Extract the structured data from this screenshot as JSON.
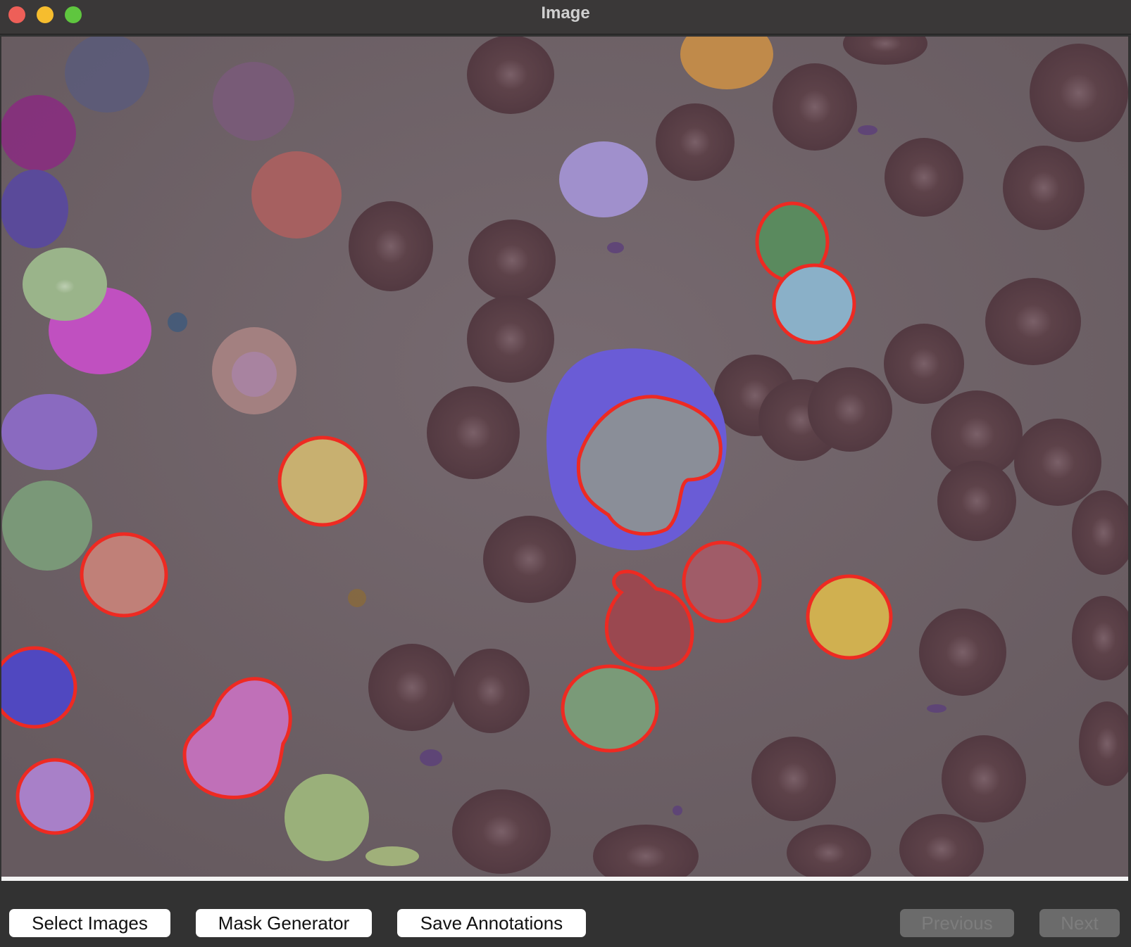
{
  "window": {
    "title": "Image"
  },
  "buttons": {
    "select_images": "Select Images",
    "mask_generator": "Mask Generator",
    "save_annotations": "Save Annotations",
    "previous": "Previous",
    "next": "Next"
  },
  "colors": {
    "background": "#6a5a5f",
    "rbc": "#5a3d47",
    "outline": "#ee2a22",
    "nucleus": "#8a8e98",
    "cytoplasm": "#6a5cd6"
  }
}
